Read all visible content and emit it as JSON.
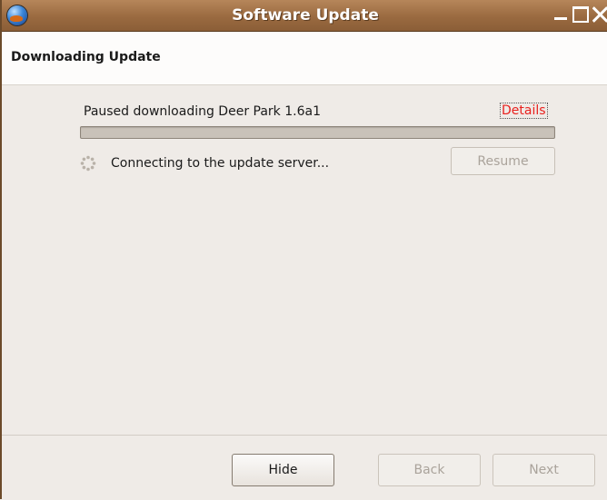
{
  "window": {
    "title": "Software Update",
    "controls": {
      "minimize": "minimize-icon",
      "maximize": "maximize-icon",
      "close": "close-icon"
    }
  },
  "header": {
    "title": "Downloading Update"
  },
  "download": {
    "status": "Paused downloading Deer Park 1.6a1",
    "details_label": "Details",
    "progress": 0,
    "connection_status": "Connecting to the update server...",
    "resume_label": "Resume",
    "resume_enabled": false
  },
  "footer": {
    "hide_label": "Hide",
    "back_label": "Back",
    "next_label": "Next"
  },
  "colors": {
    "titlebar": "#9a6a40",
    "details_link": "#e8211e",
    "window_bg": "#efebe7"
  }
}
